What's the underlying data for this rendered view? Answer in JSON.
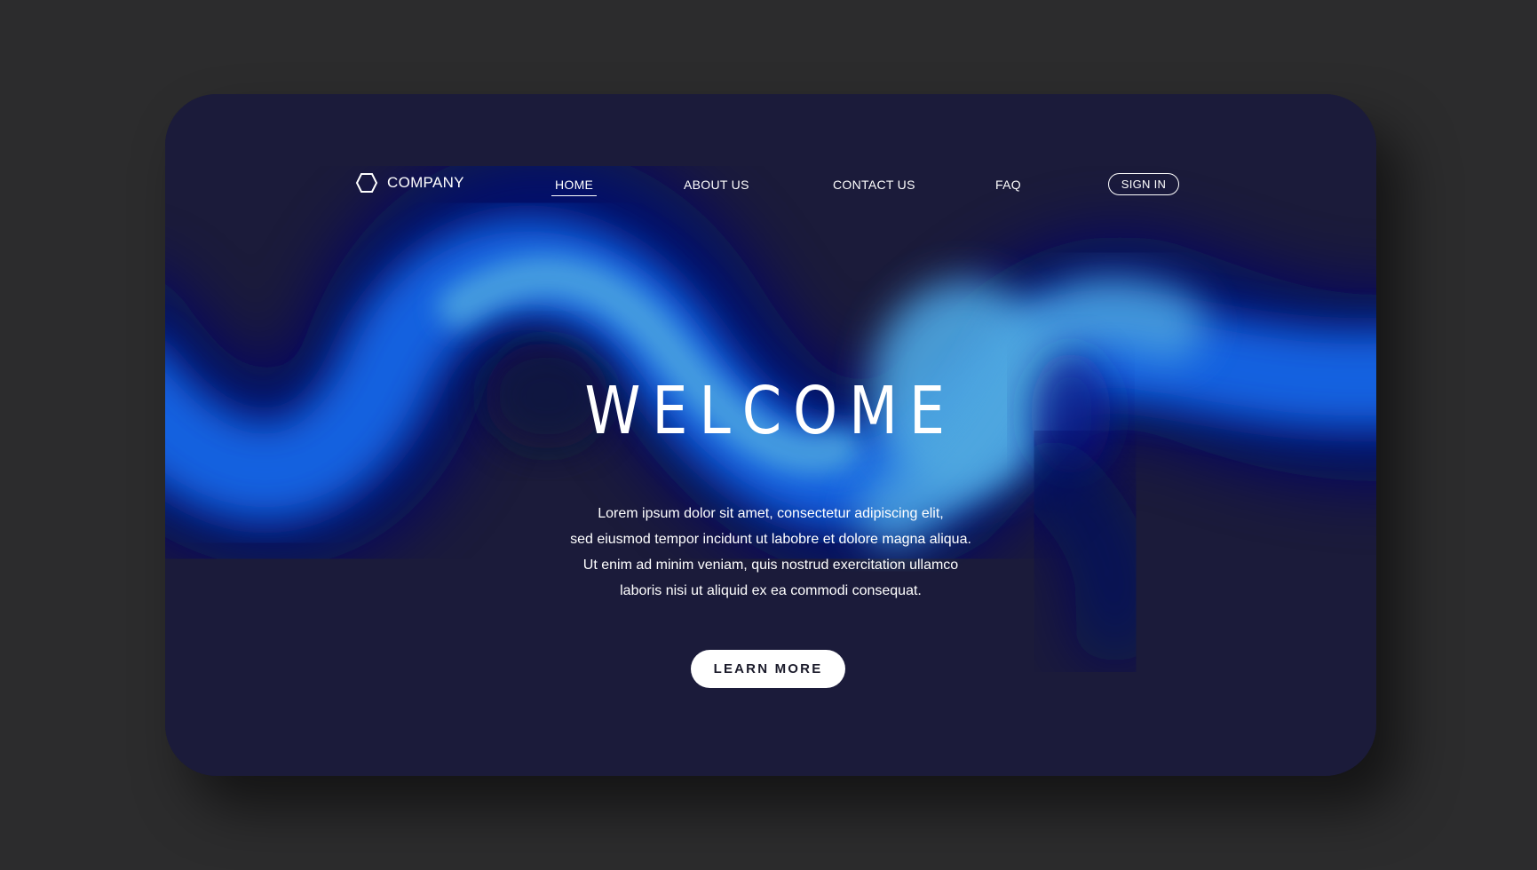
{
  "nav": {
    "brand": {
      "icon": "hexagon-icon",
      "label": "COMPANY"
    },
    "links": [
      {
        "label": "HOME",
        "active": true
      },
      {
        "label": "ABOUT US",
        "active": false
      },
      {
        "label": "CONTACT US",
        "active": false
      },
      {
        "label": "FAQ",
        "active": false
      }
    ],
    "sign_in": "SIGN IN"
  },
  "hero": {
    "title": "WELCOME",
    "lines": [
      "Lorem ipsum dolor sit amet, consectetur adipiscing elit,",
      "sed eiusmod tempor incidunt ut labobre et dolore magna aliqua.",
      "Ut enim ad minim veniam, quis nostrud exercitation ullamco",
      "laboris nisi ut aliquid ex ea commodi consequat."
    ],
    "cta": "LEARN MORE"
  },
  "colors": {
    "page_bg": "#2c2c2d",
    "card_bg": "#1b1b3a",
    "wave_deep": "#020c6e",
    "wave_mid": "#1766e6",
    "wave_light": "#4fa8e0",
    "text": "#ffffff"
  }
}
